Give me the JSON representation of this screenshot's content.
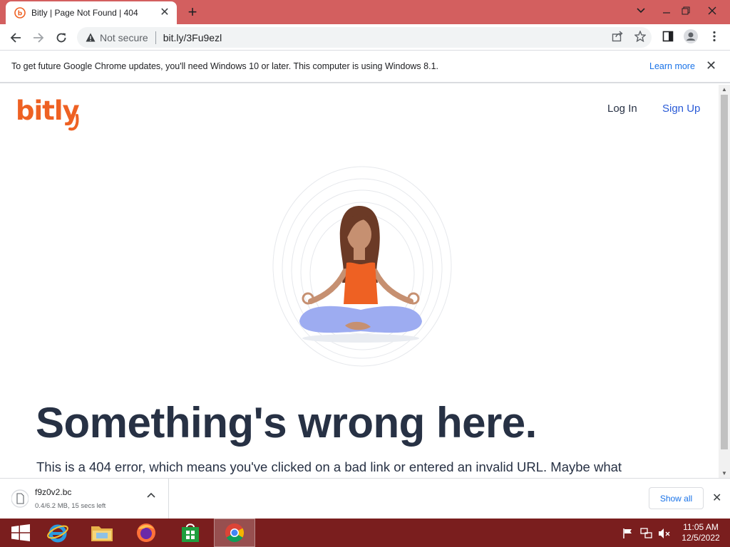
{
  "browser": {
    "tab_title": "Bitly | Page Not Found | 404",
    "security_label": "Not secure",
    "url": "bit.ly/3Fu9ezl",
    "infobar_message": "To get future Google Chrome updates, you'll need Windows 10 or later. This computer is using Windows 8.1.",
    "infobar_link": "Learn more"
  },
  "page": {
    "logo_text": "bitly",
    "nav": {
      "login": "Log In",
      "signup": "Sign Up"
    },
    "headline": "Something's wrong here.",
    "body": "This is a 404 error, which means you've clicked on a bad link or entered an invalid URL. Maybe what"
  },
  "downloads": {
    "filename": "f9z0v2.bc",
    "status": "0.4/6.2 MB, 15 secs left",
    "show_all": "Show all"
  },
  "taskbar": {
    "time": "11:05 AM",
    "date": "12/5/2022"
  },
  "colors": {
    "tabstrip": "#d35f5f",
    "taskbar": "#7a1e1e",
    "brand_orange": "#ee6123",
    "link_blue": "#1a73e8",
    "text_dark": "#273144"
  }
}
